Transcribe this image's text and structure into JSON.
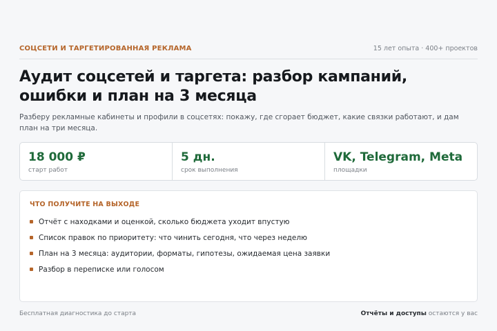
{
  "header": {
    "kicker": "СОЦСЕТИ И ТАРГЕТИРОВАННАЯ РЕКЛАМА",
    "meta": "15 лет опыта · 400+ проектов"
  },
  "title": "Аудит соцсетей и таргета: разбор кампаний, ошибки и план на 3 месяца",
  "lead": "Разберу рекламные кабинеты и профили в соцсетях: покажу, где сгорает бюджет, какие связки работают, и дам план на три месяца.",
  "stats": [
    {
      "value": "18 000 ₽",
      "label": "старт работ"
    },
    {
      "value": "5 дн.",
      "label": "срок выполнения"
    },
    {
      "value": "VK, Telegram, Meta",
      "label": "площадки"
    }
  ],
  "deliverables": {
    "title": "ЧТО ПОЛУЧИТЕ НА ВЫХОДЕ",
    "items": [
      "Отчёт с находками и оценкой, сколько бюджета уходит впустую",
      "Список правок по приоритету: что чинить сегодня, что через неделю",
      "План на 3 месяца: аудитории, форматы, гипотезы, ожидаемая цена заявки",
      "Разбор в переписке или голосом"
    ]
  },
  "footer": {
    "left": "Бесплатная диагностика до старта",
    "right_bold": "Отчёты и доступы",
    "right_rest": " остаются у вас"
  },
  "colors": {
    "accent": "#b5652a",
    "value_green": "#1f6a3a",
    "background": "#f6f7f9"
  }
}
